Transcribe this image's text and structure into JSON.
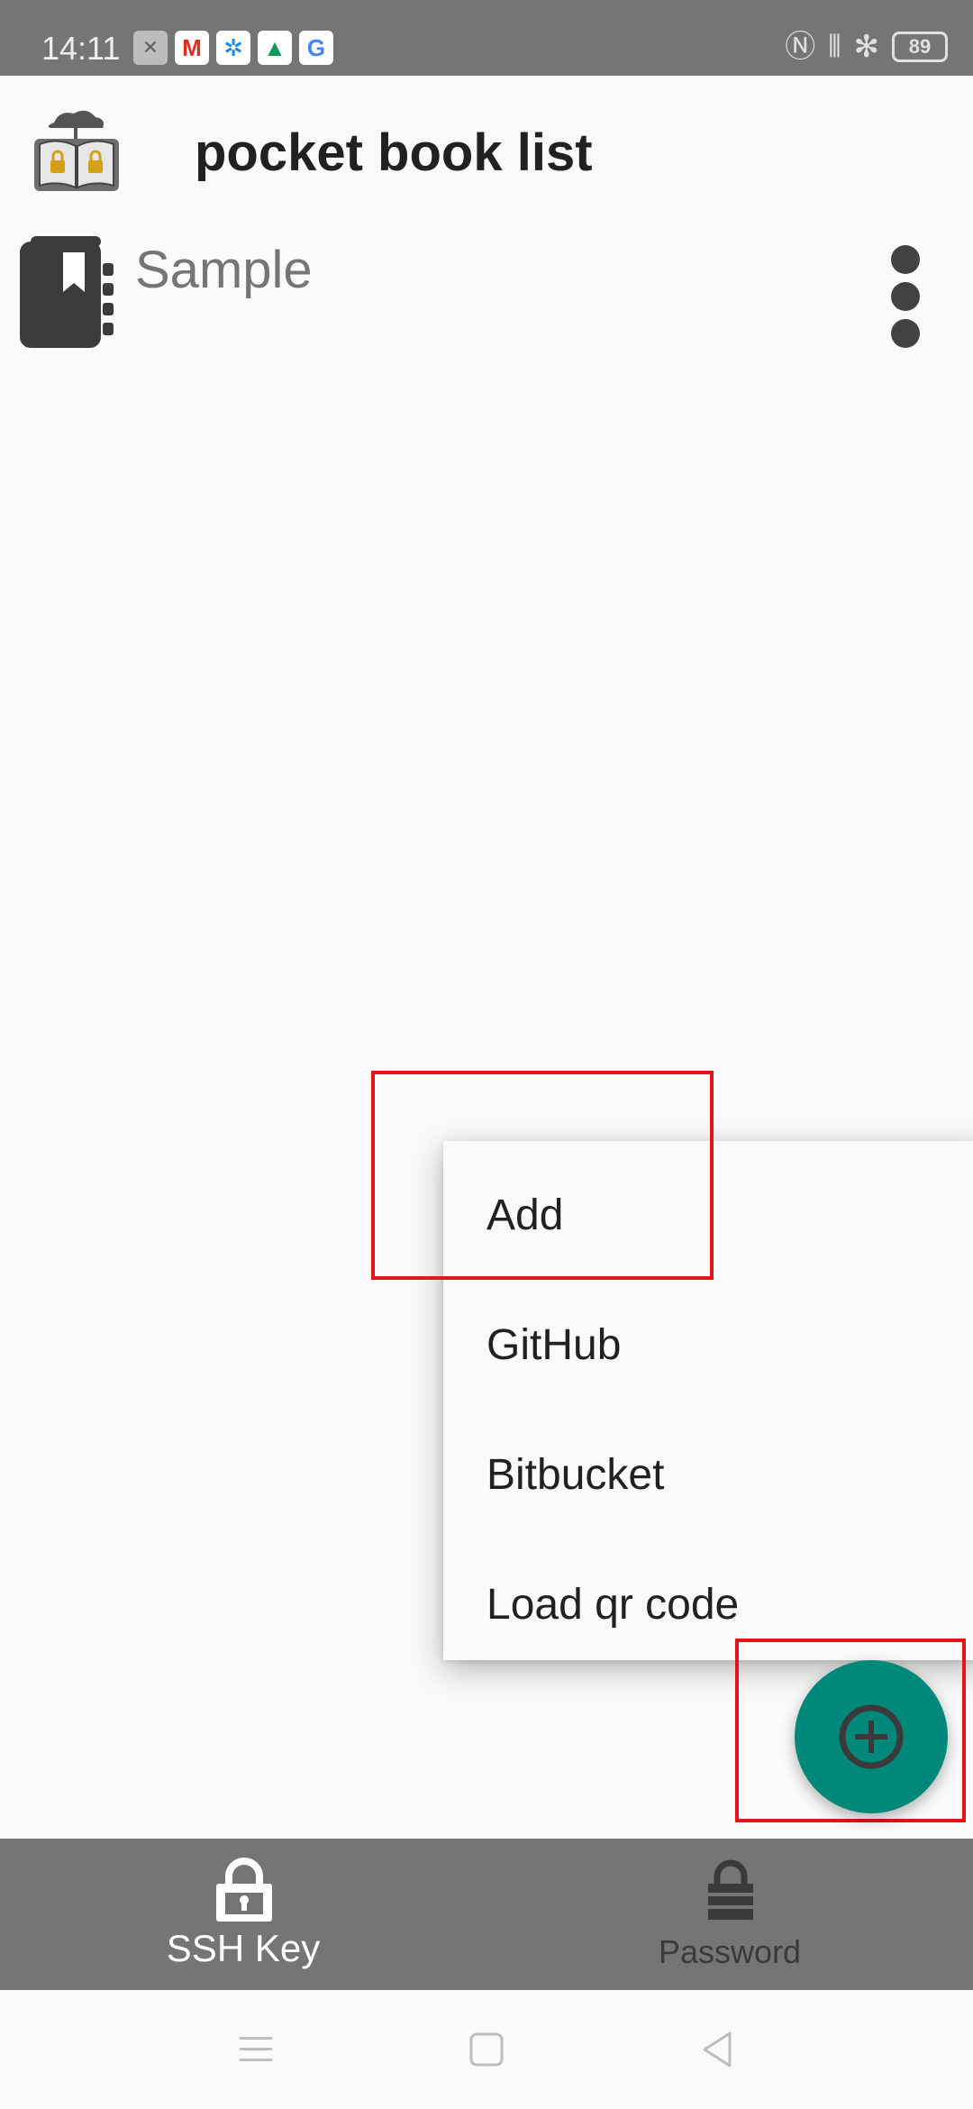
{
  "status_bar": {
    "time": "14:11",
    "notification_icons": [
      "close-box-icon",
      "gmail-icon",
      "pinwheel-icon",
      "drive-icon",
      "google-icon"
    ],
    "system_icons": [
      "nfc-icon",
      "vibrate-icon",
      "bluetooth-icon"
    ],
    "battery_level": "89"
  },
  "app_bar": {
    "title": "pocket book list"
  },
  "list": {
    "items": [
      {
        "label": "Sample",
        "icon": "book-icon"
      }
    ]
  },
  "popup_menu": {
    "items": [
      "Add",
      "GitHub",
      "Bitbucket",
      "Load qr code"
    ]
  },
  "fab": {
    "icon": "add-circle-icon"
  },
  "bottom_nav": {
    "tabs": [
      {
        "label": "SSH Key",
        "icon": "lock-icon",
        "selected": true
      },
      {
        "label": "Password",
        "icon": "padlock-icon",
        "selected": false
      }
    ]
  },
  "system_nav": [
    "menu-icon",
    "home-icon",
    "back-icon"
  ],
  "colors": {
    "accent": "#00897b",
    "bars": "#757575",
    "highlight": "#e5141c"
  }
}
